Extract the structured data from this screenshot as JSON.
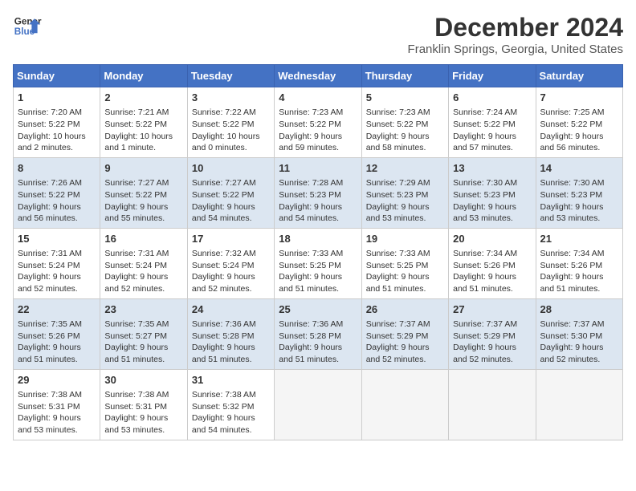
{
  "logo": {
    "line1": "General",
    "line2": "Blue"
  },
  "title": "December 2024",
  "subtitle": "Franklin Springs, Georgia, United States",
  "header": {
    "days": [
      "Sunday",
      "Monday",
      "Tuesday",
      "Wednesday",
      "Thursday",
      "Friday",
      "Saturday"
    ]
  },
  "weeks": [
    [
      {
        "day": "1",
        "sunrise": "Sunrise: 7:20 AM",
        "sunset": "Sunset: 5:22 PM",
        "daylight": "Daylight: 10 hours and 2 minutes."
      },
      {
        "day": "2",
        "sunrise": "Sunrise: 7:21 AM",
        "sunset": "Sunset: 5:22 PM",
        "daylight": "Daylight: 10 hours and 1 minute."
      },
      {
        "day": "3",
        "sunrise": "Sunrise: 7:22 AM",
        "sunset": "Sunset: 5:22 PM",
        "daylight": "Daylight: 10 hours and 0 minutes."
      },
      {
        "day": "4",
        "sunrise": "Sunrise: 7:23 AM",
        "sunset": "Sunset: 5:22 PM",
        "daylight": "Daylight: 9 hours and 59 minutes."
      },
      {
        "day": "5",
        "sunrise": "Sunrise: 7:23 AM",
        "sunset": "Sunset: 5:22 PM",
        "daylight": "Daylight: 9 hours and 58 minutes."
      },
      {
        "day": "6",
        "sunrise": "Sunrise: 7:24 AM",
        "sunset": "Sunset: 5:22 PM",
        "daylight": "Daylight: 9 hours and 57 minutes."
      },
      {
        "day": "7",
        "sunrise": "Sunrise: 7:25 AM",
        "sunset": "Sunset: 5:22 PM",
        "daylight": "Daylight: 9 hours and 56 minutes."
      }
    ],
    [
      {
        "day": "8",
        "sunrise": "Sunrise: 7:26 AM",
        "sunset": "Sunset: 5:22 PM",
        "daylight": "Daylight: 9 hours and 56 minutes."
      },
      {
        "day": "9",
        "sunrise": "Sunrise: 7:27 AM",
        "sunset": "Sunset: 5:22 PM",
        "daylight": "Daylight: 9 hours and 55 minutes."
      },
      {
        "day": "10",
        "sunrise": "Sunrise: 7:27 AM",
        "sunset": "Sunset: 5:22 PM",
        "daylight": "Daylight: 9 hours and 54 minutes."
      },
      {
        "day": "11",
        "sunrise": "Sunrise: 7:28 AM",
        "sunset": "Sunset: 5:23 PM",
        "daylight": "Daylight: 9 hours and 54 minutes."
      },
      {
        "day": "12",
        "sunrise": "Sunrise: 7:29 AM",
        "sunset": "Sunset: 5:23 PM",
        "daylight": "Daylight: 9 hours and 53 minutes."
      },
      {
        "day": "13",
        "sunrise": "Sunrise: 7:30 AM",
        "sunset": "Sunset: 5:23 PM",
        "daylight": "Daylight: 9 hours and 53 minutes."
      },
      {
        "day": "14",
        "sunrise": "Sunrise: 7:30 AM",
        "sunset": "Sunset: 5:23 PM",
        "daylight": "Daylight: 9 hours and 53 minutes."
      }
    ],
    [
      {
        "day": "15",
        "sunrise": "Sunrise: 7:31 AM",
        "sunset": "Sunset: 5:24 PM",
        "daylight": "Daylight: 9 hours and 52 minutes."
      },
      {
        "day": "16",
        "sunrise": "Sunrise: 7:31 AM",
        "sunset": "Sunset: 5:24 PM",
        "daylight": "Daylight: 9 hours and 52 minutes."
      },
      {
        "day": "17",
        "sunrise": "Sunrise: 7:32 AM",
        "sunset": "Sunset: 5:24 PM",
        "daylight": "Daylight: 9 hours and 52 minutes."
      },
      {
        "day": "18",
        "sunrise": "Sunrise: 7:33 AM",
        "sunset": "Sunset: 5:25 PM",
        "daylight": "Daylight: 9 hours and 51 minutes."
      },
      {
        "day": "19",
        "sunrise": "Sunrise: 7:33 AM",
        "sunset": "Sunset: 5:25 PM",
        "daylight": "Daylight: 9 hours and 51 minutes."
      },
      {
        "day": "20",
        "sunrise": "Sunrise: 7:34 AM",
        "sunset": "Sunset: 5:26 PM",
        "daylight": "Daylight: 9 hours and 51 minutes."
      },
      {
        "day": "21",
        "sunrise": "Sunrise: 7:34 AM",
        "sunset": "Sunset: 5:26 PM",
        "daylight": "Daylight: 9 hours and 51 minutes."
      }
    ],
    [
      {
        "day": "22",
        "sunrise": "Sunrise: 7:35 AM",
        "sunset": "Sunset: 5:26 PM",
        "daylight": "Daylight: 9 hours and 51 minutes."
      },
      {
        "day": "23",
        "sunrise": "Sunrise: 7:35 AM",
        "sunset": "Sunset: 5:27 PM",
        "daylight": "Daylight: 9 hours and 51 minutes."
      },
      {
        "day": "24",
        "sunrise": "Sunrise: 7:36 AM",
        "sunset": "Sunset: 5:28 PM",
        "daylight": "Daylight: 9 hours and 51 minutes."
      },
      {
        "day": "25",
        "sunrise": "Sunrise: 7:36 AM",
        "sunset": "Sunset: 5:28 PM",
        "daylight": "Daylight: 9 hours and 51 minutes."
      },
      {
        "day": "26",
        "sunrise": "Sunrise: 7:37 AM",
        "sunset": "Sunset: 5:29 PM",
        "daylight": "Daylight: 9 hours and 52 minutes."
      },
      {
        "day": "27",
        "sunrise": "Sunrise: 7:37 AM",
        "sunset": "Sunset: 5:29 PM",
        "daylight": "Daylight: 9 hours and 52 minutes."
      },
      {
        "day": "28",
        "sunrise": "Sunrise: 7:37 AM",
        "sunset": "Sunset: 5:30 PM",
        "daylight": "Daylight: 9 hours and 52 minutes."
      }
    ],
    [
      {
        "day": "29",
        "sunrise": "Sunrise: 7:38 AM",
        "sunset": "Sunset: 5:31 PM",
        "daylight": "Daylight: 9 hours and 53 minutes."
      },
      {
        "day": "30",
        "sunrise": "Sunrise: 7:38 AM",
        "sunset": "Sunset: 5:31 PM",
        "daylight": "Daylight: 9 hours and 53 minutes."
      },
      {
        "day": "31",
        "sunrise": "Sunrise: 7:38 AM",
        "sunset": "Sunset: 5:32 PM",
        "daylight": "Daylight: 9 hours and 54 minutes."
      },
      null,
      null,
      null,
      null
    ]
  ]
}
